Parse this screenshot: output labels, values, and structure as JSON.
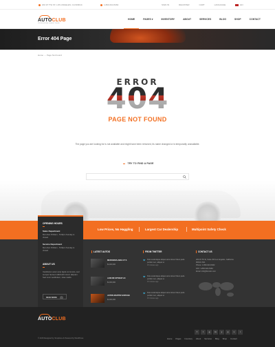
{
  "topbar": {
    "address": "202 W 7TH ST, LOS ANGELES, CA 900014",
    "phone": "1-800-624-5462",
    "links": [
      "SIGN IN",
      "REGISTER",
      "CART",
      "LANGUAGE"
    ],
    "lang": "EN"
  },
  "brand": {
    "name_a": "AUTO",
    "name_b": "CLUB",
    "tagline": "PROFESSIONAL DEALER THEME"
  },
  "nav": [
    {
      "label": "HOME"
    },
    {
      "label": "PAGES"
    },
    {
      "label": "INVENTORY"
    },
    {
      "label": "ABOUT"
    },
    {
      "label": "SERVICES"
    },
    {
      "label": "BLOG"
    },
    {
      "label": "SHOP"
    },
    {
      "label": "CONTACT"
    }
  ],
  "hero": {
    "title": "Error 404 Page"
  },
  "breadcrumb": {
    "home": "Home",
    "current": "Page Not Found"
  },
  "error": {
    "word": "ERROR",
    "code": "404",
    "subtitle": "PAGE NOT FOUND",
    "message": "The page you are looking for is not available and might have been removed, its name changed or is temporarily unavailable.",
    "try_label": "TRY TO FIND A PAGE",
    "search_placeholder": ""
  },
  "band": {
    "items": [
      "Low Prices, No Haggling",
      "Largest Car Dealership",
      "Multipoint Safety Check"
    ]
  },
  "hours": {
    "title": "OPENING HOURS",
    "sales_title": "Sales Department",
    "sales_hours": "Mon-Sat: 8:00am - 5:00pm Sunday is closed",
    "service_title": "Service Department",
    "service_hours": "Mon-Sat: 8:00am - 5:00pm Sunday is closed",
    "about_title": "ABOUT US",
    "about_text": "Vestibulum autor ante ligula commodo, sed semper laoreet sollicitudin lorem aliquam. Sed nunc vestibulum, vitae mattis.",
    "read_more": "READ MORE"
  },
  "latest_autos": {
    "title": "LATEST AUTOS",
    "items": [
      {
        "name": "MERCEDES-AMG GT S",
        "price": "$1,000,000"
      },
      {
        "name": "AUDI R8 SPYDER V-8",
        "price": "$1,000,000"
      },
      {
        "name": "ASTON MARTIN VANTAGE",
        "price": "$1,000,000"
      }
    ]
  },
  "twitter": {
    "title": "FROM TWITTER",
    "items": [
      {
        "text": "Duis scelerisque aliquet ante donec libero pede portitor nec, aliquet ut.",
        "time": "15 minutes ago"
      },
      {
        "text": "Duis scelerisque aliquet ante donec libero pede portitor nec, aliquet ut.",
        "time": "15 minutes ago"
      },
      {
        "text": "Duis scelerisque aliquet ante donec libero pede portitor nec, aliquet ut.",
        "time": "15 minutes ago"
      }
    ]
  },
  "contact": {
    "title": "CONTACT US",
    "lines": [
      "202 W 7th St, Suite 233 Los Angeles, California 90014 USA",
      "Phone: 1-800-624-5462",
      "FAX: 1-800-624-5462",
      "Email: info@domain.com"
    ]
  },
  "footer": {
    "copyright": "© 2015 Designed by Templines & Powered by WordPress",
    "nav": [
      "Home",
      "Pages",
      "Inventory",
      "About",
      "Services",
      "Blog",
      "Shop",
      "Contact"
    ],
    "socials": [
      "f",
      "t",
      "g",
      "in",
      "y",
      "p",
      "v",
      "r"
    ]
  },
  "colors": {
    "accent": "#f36f21",
    "dark": "#333333",
    "darker": "#222222"
  }
}
